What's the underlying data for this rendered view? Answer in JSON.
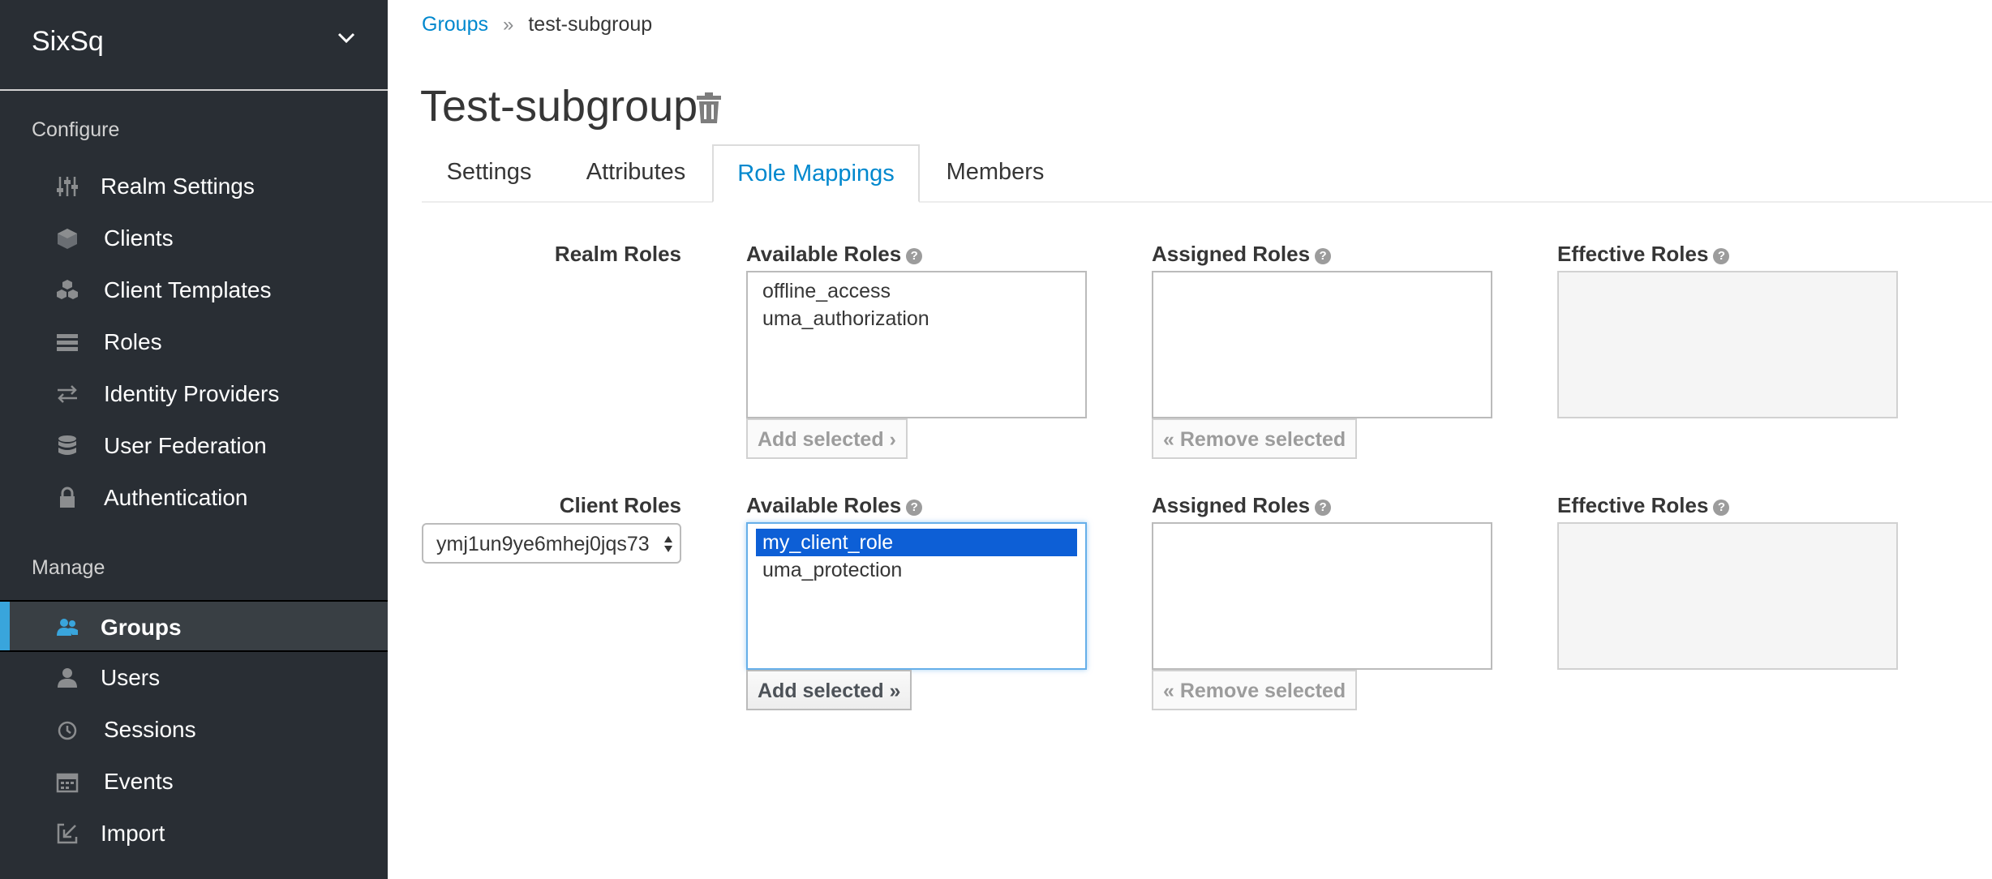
{
  "sidebar": {
    "realm": "SixSq",
    "sections": {
      "configure": "Configure",
      "manage": "Manage"
    },
    "configure_items": [
      {
        "label": "Realm Settings",
        "icon": "sliders-icon"
      },
      {
        "label": "Clients",
        "icon": "cube-icon"
      },
      {
        "label": "Client Templates",
        "icon": "cubes-icon"
      },
      {
        "label": "Roles",
        "icon": "list-icon"
      },
      {
        "label": "Identity Providers",
        "icon": "exchange-icon"
      },
      {
        "label": "User Federation",
        "icon": "database-icon"
      },
      {
        "label": "Authentication",
        "icon": "lock-icon"
      }
    ],
    "manage_items": [
      {
        "label": "Groups",
        "icon": "users-icon",
        "active": true
      },
      {
        "label": "Users",
        "icon": "user-icon"
      },
      {
        "label": "Sessions",
        "icon": "clock-icon"
      },
      {
        "label": "Events",
        "icon": "calendar-icon"
      },
      {
        "label": "Import",
        "icon": "import-icon"
      }
    ]
  },
  "breadcrumb": {
    "link": "Groups",
    "separator": "»",
    "current": "test-subgroup"
  },
  "page": {
    "title": "Test-subgroup"
  },
  "tabs": [
    "Settings",
    "Attributes",
    "Role Mappings",
    "Members"
  ],
  "active_tab": "Role Mappings",
  "realm_roles": {
    "label": "Realm Roles",
    "available_header": "Available Roles",
    "assigned_header": "Assigned Roles",
    "effective_header": "Effective Roles",
    "available": [
      "offline_access",
      "uma_authorization"
    ],
    "add_button": "Add selected ›",
    "remove_button": "« Remove selected"
  },
  "client_roles": {
    "label": "Client Roles",
    "client_value": "ymj1un9ye6mhej0jqs73",
    "available_header": "Available Roles",
    "assigned_header": "Assigned Roles",
    "effective_header": "Effective Roles",
    "available": [
      "my_client_role",
      "uma_protection"
    ],
    "selected": "my_client_role",
    "add_button": "Add selected »",
    "remove_button": "« Remove selected"
  },
  "colors": {
    "sidebar_bg": "#292e34",
    "accent": "#0088ce",
    "active_bar": "#39a5dc",
    "selection": "#0d5fd6"
  }
}
